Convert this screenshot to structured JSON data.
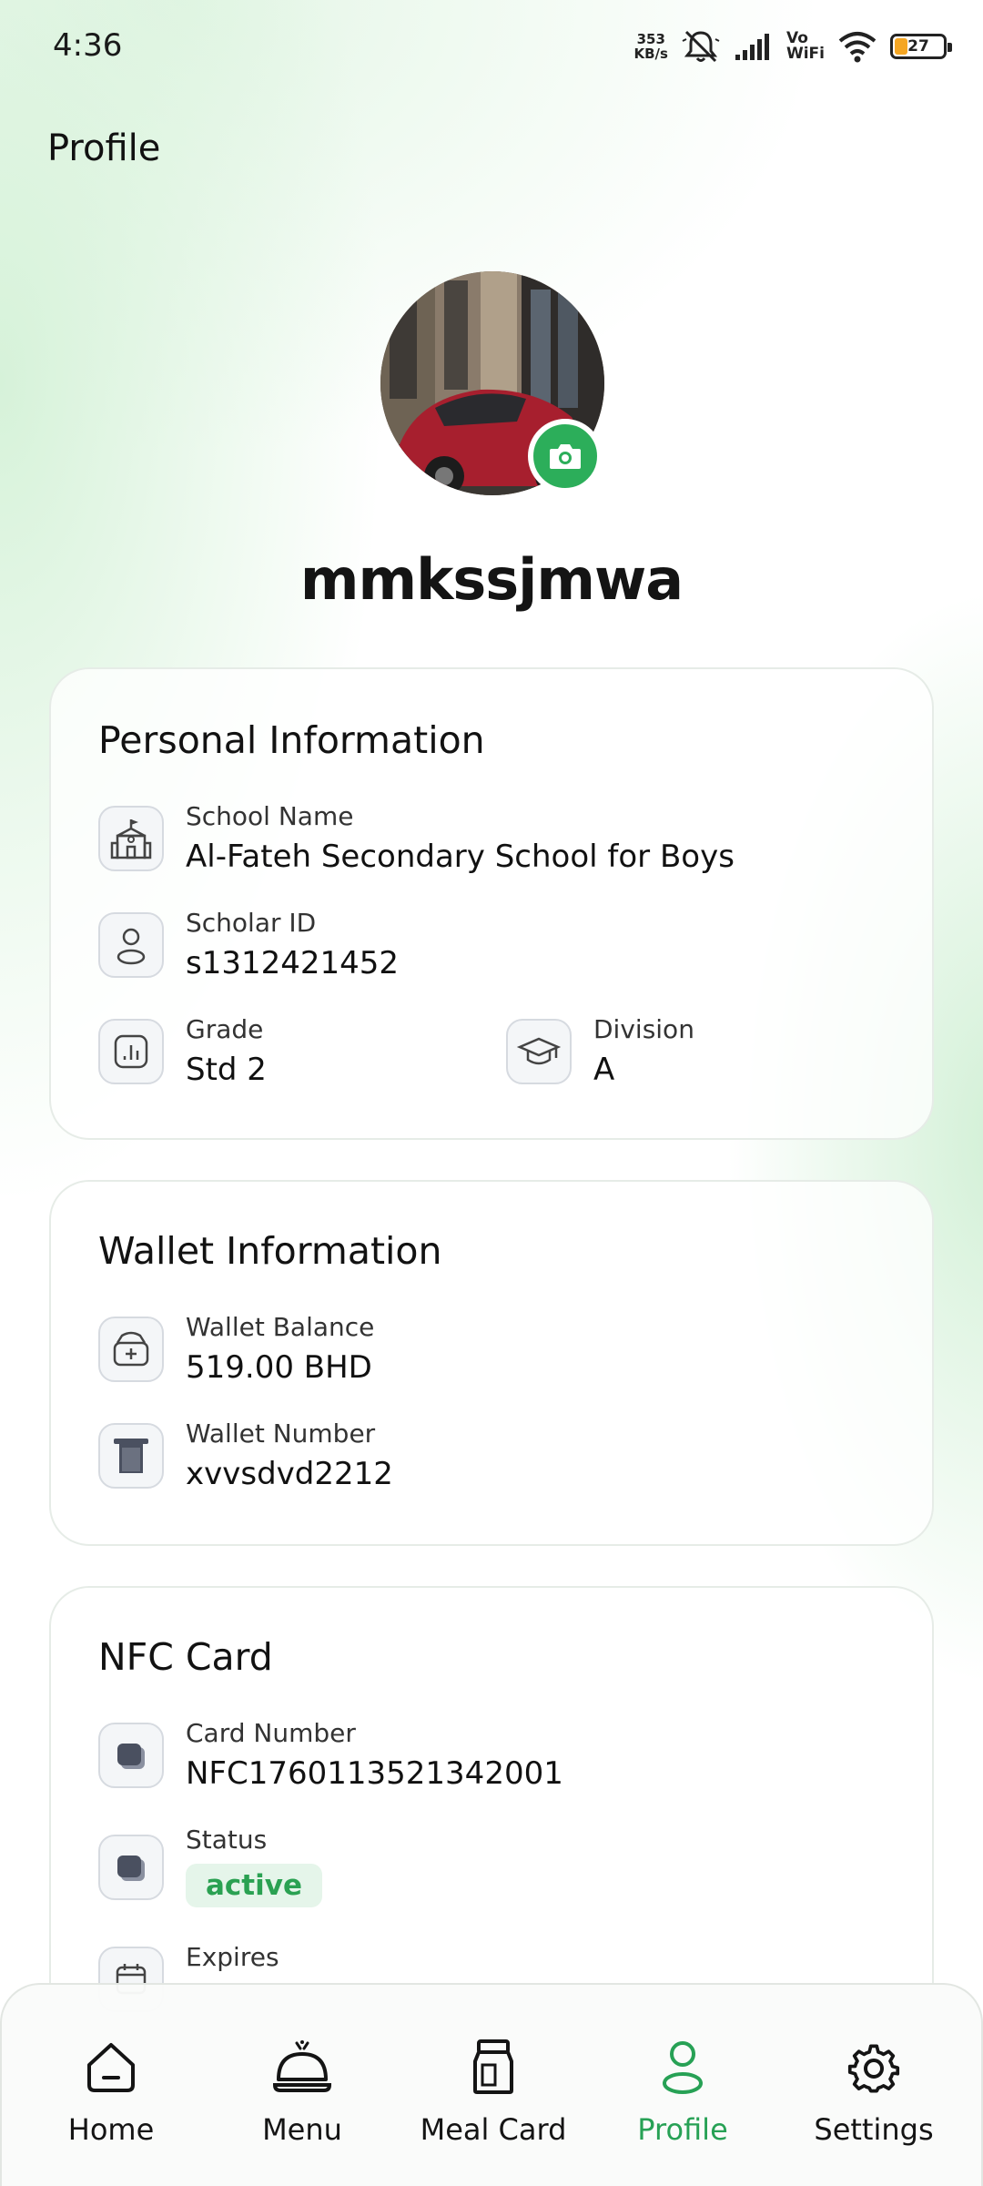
{
  "status_bar": {
    "time": "4:36",
    "net_speed_value": "353",
    "net_speed_unit": "KB/s",
    "vowifi_line1": "Vo",
    "vowifi_line2": "WiFi",
    "battery": "27"
  },
  "header": {
    "title": "Profile"
  },
  "profile": {
    "username": "mmkssjmwa"
  },
  "personal_info": {
    "title": "Personal Information",
    "school_label": "School Name",
    "school_value": "Al-Fateh Secondary School for Boys",
    "scholar_label": "Scholar ID",
    "scholar_value": "s1312421452",
    "grade_label": "Grade",
    "grade_value": "Std 2",
    "division_label": "Division",
    "division_value": "A"
  },
  "wallet_info": {
    "title": "Wallet Information",
    "balance_label": "Wallet Balance",
    "balance_value": "519.00 BHD",
    "number_label": "Wallet Number",
    "number_value": "xvvsdvd2212"
  },
  "nfc_card": {
    "title": "NFC Card",
    "card_number_label": "Card Number",
    "card_number_value": "NFC1760113521342001",
    "status_label": "Status",
    "status_value": "active",
    "expires_label": "Expires"
  },
  "bottom_nav": {
    "items": [
      {
        "label": "Home",
        "icon": "home-icon"
      },
      {
        "label": "Menu",
        "icon": "cloche-icon"
      },
      {
        "label": "Meal Card",
        "icon": "bag-icon"
      },
      {
        "label": "Profile",
        "icon": "person-icon"
      },
      {
        "label": "Settings",
        "icon": "gear-icon"
      }
    ],
    "active": "Profile"
  },
  "colors": {
    "accent": "#2cae5a",
    "active_nav": "#27a155",
    "badge_bg": "#e5f5ea"
  }
}
